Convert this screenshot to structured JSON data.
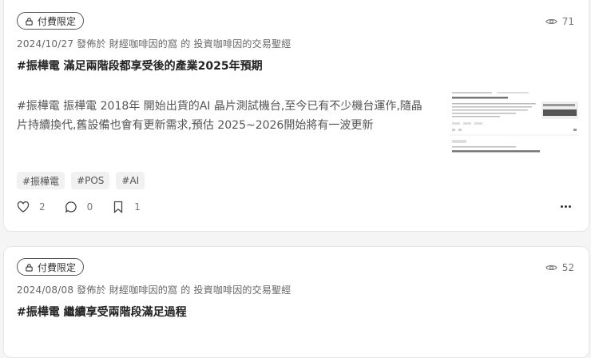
{
  "posts": [
    {
      "badge": "付費限定",
      "views": "71",
      "meta": "2024/10/27 發佈於 財經咖啡因的窩 的 投資咖啡因的交易聖經",
      "title": "#振樺電 滿足兩階段都享受後的產業2025年預期",
      "excerpt": "#振樺電 振樺電 2018年 開始出貨的AI 晶片測試機台,至今已有不少機台運作,隨晶片持續換代,舊設備也會有更新需求,預估 2025~2026開始將有一波更新",
      "tags": [
        "#振樺電",
        "#POS",
        "#AI"
      ],
      "likes": "2",
      "comments": "0",
      "bookmarks": "1"
    },
    {
      "badge": "付費限定",
      "views": "52",
      "meta": "2024/08/08 發佈於 財經咖啡因的窩 的 投資咖啡因的交易聖經",
      "title": "#振樺電 繼續享受兩階段滿足過程"
    }
  ],
  "colors": {
    "text": "#222222",
    "muted": "#666666",
    "border": "#e6e6e6",
    "tag_bg": "#f1f1f1"
  }
}
